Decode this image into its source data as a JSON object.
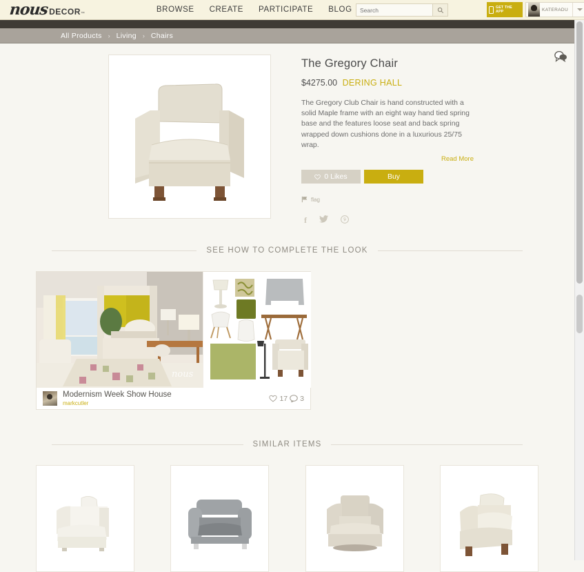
{
  "header": {
    "logo_script": "nous",
    "logo_word": "DECOR",
    "logo_tm": "™",
    "menu": [
      {
        "label": "BROWSE"
      },
      {
        "label": "CREATE"
      },
      {
        "label": "PARTICIPATE"
      },
      {
        "label": "BLOG"
      }
    ],
    "search": {
      "placeholder": "Search",
      "value": "",
      "icon": "search-icon"
    },
    "get_app": {
      "line1": "GET THE",
      "line2": "APP",
      "icon": "mobile-phone-icon",
      "color": "#c9ae10"
    },
    "user": {
      "name": "KATERADU",
      "dropdown_icon": "chevron-down-icon"
    }
  },
  "breadcrumb": {
    "items": [
      "All Products",
      "Living",
      "Chairs"
    ],
    "separator": "›"
  },
  "chat_icon": "chat-bubble-icon",
  "product": {
    "image_alt": "The Gregory Chair",
    "title": "The Gregory Chair",
    "price": "$4275.00",
    "brand": "DERING HALL",
    "brand_color": "#c9ae10",
    "description": "The Gregory Club Chair is hand constructed with a solid Maple frame with an eight way hand tied spring base and the features loose seat and back spring wrapped down cushions done in a luxurious 25/75 wrap.",
    "read_more": "Read More",
    "like_button": {
      "label": "0 Likes",
      "count": "0",
      "icon": "heart-outline-icon"
    },
    "buy_button": {
      "label": "Buy",
      "color": "#c9ae10"
    },
    "flag": {
      "label": "flag",
      "icon": "flag-icon"
    },
    "social": [
      {
        "name": "facebook-icon",
        "glyph": "f"
      },
      {
        "name": "twitter-icon",
        "glyph": "ᵗ"
      },
      {
        "name": "pinterest-icon",
        "glyph": "Ⓟ"
      }
    ]
  },
  "sections": {
    "complete_the_look": "SEE HOW TO COMPLETE THE LOOK",
    "similar_items": "SIMILAR ITEMS"
  },
  "collection": {
    "title": "Modernism Week Show House",
    "author": "markcutler",
    "likes": "17",
    "comments": "3",
    "like_icon": "heart-outline-icon",
    "comment_icon": "comment-bubble-icon",
    "photo_alt": "Bedroom with yellow canopy bed",
    "board_alt": "Mood board of furniture items",
    "watermark": "nous"
  },
  "similar_items": [
    {
      "alt": "White upholstered club chair"
    },
    {
      "alt": "Grey fabric armchair"
    },
    {
      "alt": "Beige swivel lounge chair"
    },
    {
      "alt": "Cream armchair with wooden legs"
    }
  ]
}
